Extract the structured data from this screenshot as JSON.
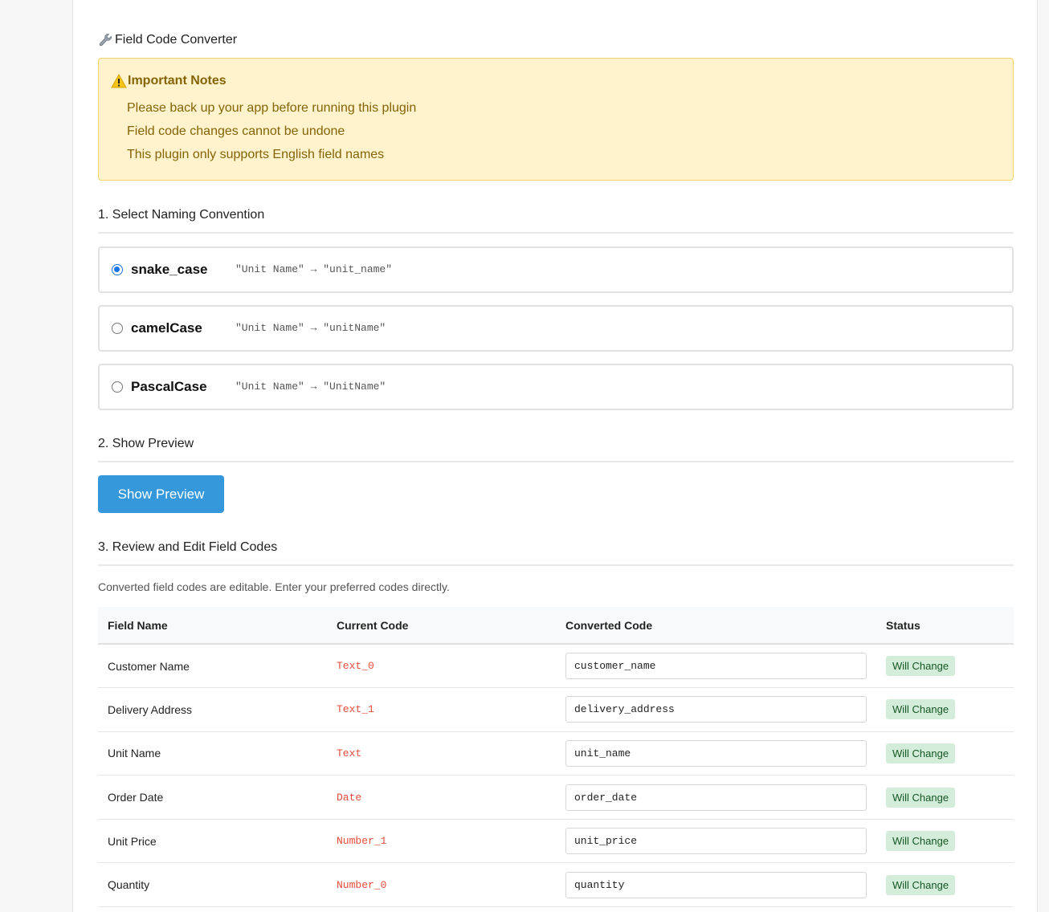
{
  "title": "Field Code Converter",
  "notes": {
    "title": "Important Notes",
    "items": [
      "Please back up your app before running this plugin",
      "Field code changes cannot be undone",
      "This plugin only supports English field names"
    ]
  },
  "sections": {
    "naming": "1. Select Naming Convention",
    "preview": "2. Show Preview",
    "review": "3. Review and Edit Field Codes"
  },
  "conventions": [
    {
      "label": "snake_case",
      "example": "\"Unit Name\" → \"unit_name\"",
      "selected": true
    },
    {
      "label": "camelCase",
      "example": "\"Unit Name\" → \"unitName\"",
      "selected": false
    },
    {
      "label": "PascalCase",
      "example": "\"Unit Name\" → \"UnitName\"",
      "selected": false
    }
  ],
  "preview_button": "Show Preview",
  "help_text": "Converted field codes are editable. Enter your preferred codes directly.",
  "table": {
    "headers": [
      "Field Name",
      "Current Code",
      "Converted Code",
      "Status"
    ],
    "rows": [
      {
        "field_name": "Customer Name",
        "current_code": "Text_0",
        "converted_code": "customer_name",
        "status": "Will Change"
      },
      {
        "field_name": "Delivery Address",
        "current_code": "Text_1",
        "converted_code": "delivery_address",
        "status": "Will Change"
      },
      {
        "field_name": "Unit Name",
        "current_code": "Text",
        "converted_code": "unit_name",
        "status": "Will Change"
      },
      {
        "field_name": "Order Date",
        "current_code": "Date",
        "converted_code": "order_date",
        "status": "Will Change"
      },
      {
        "field_name": "Unit Price",
        "current_code": "Number_1",
        "converted_code": "unit_price",
        "status": "Will Change"
      },
      {
        "field_name": "Quantity",
        "current_code": "Number_0",
        "converted_code": "quantity",
        "status": "Will Change"
      }
    ]
  },
  "colors": {
    "accent": "#3498db",
    "warning_bg": "#fff3cd",
    "warning_text": "#856404",
    "code_red": "#e74c3c",
    "badge_bg": "#d4edda",
    "badge_text": "#155724"
  }
}
